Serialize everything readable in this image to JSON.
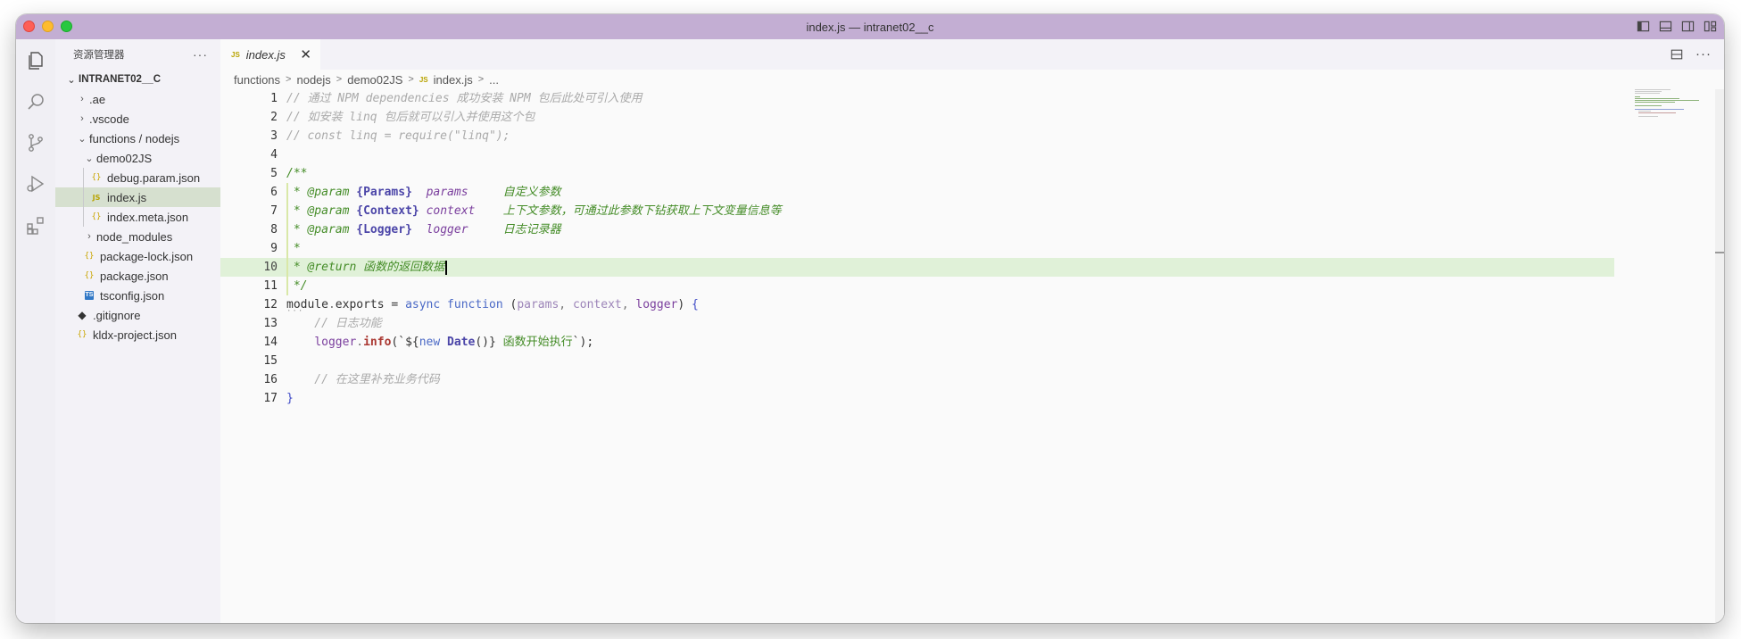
{
  "window": {
    "title": "index.js — intranet02__c"
  },
  "activity_bar": {
    "icons": [
      "explorer-icon",
      "search-icon",
      "source-control-icon",
      "run-debug-icon",
      "extensions-icon"
    ]
  },
  "sidebar": {
    "title": "资源管理器",
    "more": "···",
    "tree": [
      {
        "label": "INTRANET02__C",
        "type": "root",
        "chevron": "v",
        "indent": 0
      },
      {
        "label": ".ae",
        "type": "folder",
        "chevron": ">",
        "indent": 1
      },
      {
        "label": ".vscode",
        "type": "folder",
        "chevron": ">",
        "indent": 1
      },
      {
        "label": "functions / nodejs",
        "type": "folder",
        "chevron": "v",
        "indent": 1
      },
      {
        "label": "demo02JS",
        "type": "folder",
        "chevron": "v",
        "indent": 2
      },
      {
        "label": "debug.param.json",
        "type": "json",
        "indent": 3
      },
      {
        "label": "index.js",
        "type": "js",
        "indent": 3,
        "selected": true
      },
      {
        "label": "index.meta.json",
        "type": "json",
        "indent": 3
      },
      {
        "label": "node_modules",
        "type": "folder",
        "chevron": ">",
        "indent": 2
      },
      {
        "label": "package-lock.json",
        "type": "json",
        "indent": 2
      },
      {
        "label": "package.json",
        "type": "json",
        "indent": 2
      },
      {
        "label": "tsconfig.json",
        "type": "ts",
        "indent": 2
      },
      {
        "label": ".gitignore",
        "type": "git",
        "indent": 1
      },
      {
        "label": "kldx-project.json",
        "type": "json",
        "indent": 1
      }
    ]
  },
  "editor": {
    "tab": {
      "label": "index.js",
      "badge": "JS",
      "close": "✕"
    },
    "actions_more": "···",
    "breadcrumb": [
      "functions",
      "nodejs",
      "demo02JS",
      "index.js",
      "..."
    ],
    "active_line": 10,
    "lines": [
      {
        "n": "1",
        "tokens": [
          {
            "t": "// 通过 NPM dependencies 成功安装 NPM 包后此处可引入使用",
            "c": "c-comment"
          }
        ]
      },
      {
        "n": "2",
        "tokens": [
          {
            "t": "// 如安装 linq 包后就可以引入并使用这个包",
            "c": "c-comment"
          }
        ]
      },
      {
        "n": "3",
        "tokens": [
          {
            "t": "// const linq = require(\"linq\");",
            "c": "c-comment"
          }
        ]
      },
      {
        "n": "4",
        "tokens": []
      },
      {
        "n": "5",
        "tokens": [
          {
            "t": "/**",
            "c": "c-doc"
          }
        ]
      },
      {
        "n": "6",
        "tokens": [
          {
            "t": " * ",
            "c": "c-doc"
          },
          {
            "t": "@param",
            "c": "c-doctag"
          },
          {
            "t": " ",
            "c": "c-doc"
          },
          {
            "t": "{Params}",
            "c": "c-type"
          },
          {
            "t": "  ",
            "c": "c-doc"
          },
          {
            "t": "params",
            "c": "c-param"
          },
          {
            "t": "     自定义参数",
            "c": "c-doc"
          }
        ]
      },
      {
        "n": "7",
        "tokens": [
          {
            "t": " * ",
            "c": "c-doc"
          },
          {
            "t": "@param",
            "c": "c-doctag"
          },
          {
            "t": " ",
            "c": "c-doc"
          },
          {
            "t": "{Context}",
            "c": "c-type"
          },
          {
            "t": " ",
            "c": "c-doc"
          },
          {
            "t": "context",
            "c": "c-param"
          },
          {
            "t": "    上下文参数，可通过此参数下钻获取上下文变量信息等",
            "c": "c-doc"
          }
        ]
      },
      {
        "n": "8",
        "tokens": [
          {
            "t": " * ",
            "c": "c-doc"
          },
          {
            "t": "@param",
            "c": "c-doctag"
          },
          {
            "t": " ",
            "c": "c-doc"
          },
          {
            "t": "{Logger}",
            "c": "c-type"
          },
          {
            "t": "  ",
            "c": "c-doc"
          },
          {
            "t": "logger",
            "c": "c-param"
          },
          {
            "t": "     日志记录器",
            "c": "c-doc"
          }
        ]
      },
      {
        "n": "9",
        "tokens": [
          {
            "t": " *",
            "c": "c-doc"
          }
        ]
      },
      {
        "n": "10",
        "tokens": [
          {
            "t": " * ",
            "c": "c-doc"
          },
          {
            "t": "@return",
            "c": "c-doctag"
          },
          {
            "t": " 函数的返回数据",
            "c": "c-doc"
          }
        ]
      },
      {
        "n": "11",
        "tokens": [
          {
            "t": " */",
            "c": "c-doc"
          }
        ]
      },
      {
        "n": "12",
        "tokens": [
          {
            "t": "module",
            "c": "c-plain"
          },
          {
            "t": ".",
            "c": "c-punct"
          },
          {
            "t": "exports",
            "c": "c-plain"
          },
          {
            "t": " = ",
            "c": "c-plain"
          },
          {
            "t": "async",
            "c": "c-kw"
          },
          {
            "t": " ",
            "c": "c-plain"
          },
          {
            "t": "function",
            "c": "c-kw"
          },
          {
            "t": " (",
            "c": "c-plain"
          },
          {
            "t": "params",
            "c": "c-param-light"
          },
          {
            "t": ", ",
            "c": "c-punct"
          },
          {
            "t": "context",
            "c": "c-param-light"
          },
          {
            "t": ", ",
            "c": "c-punct"
          },
          {
            "t": "logger",
            "c": "c-var"
          },
          {
            "t": ") ",
            "c": "c-plain"
          },
          {
            "t": "{",
            "c": "c-brace"
          }
        ]
      },
      {
        "n": "13",
        "tokens": [
          {
            "t": "    // 日志功能",
            "c": "c-comment"
          }
        ]
      },
      {
        "n": "14",
        "tokens": [
          {
            "t": "    ",
            "c": "c-plain"
          },
          {
            "t": "logger",
            "c": "c-var"
          },
          {
            "t": ".",
            "c": "c-punct"
          },
          {
            "t": "info",
            "c": "c-fn"
          },
          {
            "t": "(`",
            "c": "c-plain"
          },
          {
            "t": "${",
            "c": "c-plain"
          },
          {
            "t": "new",
            "c": "c-kw"
          },
          {
            "t": " ",
            "c": "c-plain"
          },
          {
            "t": "Date",
            "c": "c-bold"
          },
          {
            "t": "()",
            "c": "c-plain"
          },
          {
            "t": "}",
            "c": "c-plain"
          },
          {
            "t": " 函数开始执行",
            "c": "c-str"
          },
          {
            "t": "`);",
            "c": "c-plain"
          }
        ]
      },
      {
        "n": "15",
        "tokens": []
      },
      {
        "n": "16",
        "tokens": [
          {
            "t": "    // 在这里补充业务代码",
            "c": "c-comment"
          }
        ]
      },
      {
        "n": "17",
        "tokens": [
          {
            "t": "}",
            "c": "c-brace"
          }
        ]
      }
    ]
  }
}
